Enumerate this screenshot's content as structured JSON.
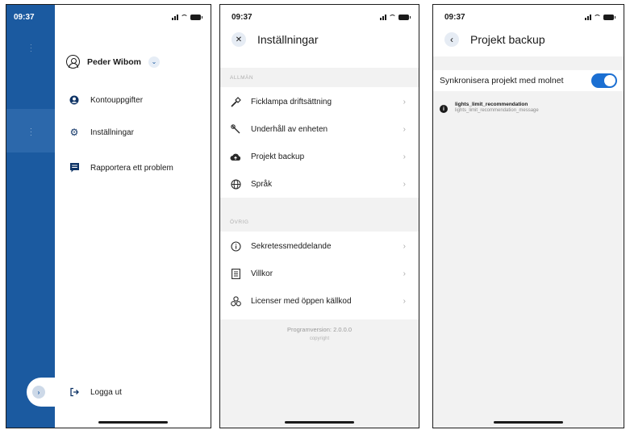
{
  "status": {
    "time": "09:37"
  },
  "drawer": {
    "profile_name": "Peder Wibom",
    "items": [
      {
        "label": "Kontouppgifter",
        "icon": "account-icon"
      },
      {
        "label": "Inställningar",
        "icon": "gear-icon"
      },
      {
        "label": "Rapportera ett problem",
        "icon": "report-icon"
      }
    ],
    "logout_label": "Logga ut"
  },
  "settings": {
    "title": "Inställningar",
    "section_general": "ALLMÄN",
    "general_items": [
      {
        "label": "Ficklampa driftsättning",
        "icon": "flashlight-icon"
      },
      {
        "label": "Underhåll av enheten",
        "icon": "wrench-icon"
      },
      {
        "label": "Projekt backup",
        "icon": "cloud-upload-icon"
      },
      {
        "label": "Språk",
        "icon": "globe-icon"
      }
    ],
    "section_other": "ÖVRIG",
    "other_items": [
      {
        "label": "Sekretessmeddelande",
        "icon": "info-circle-icon"
      },
      {
        "label": "Villkor",
        "icon": "document-icon"
      },
      {
        "label": "Licenser med öppen källkod",
        "icon": "open-source-icon"
      }
    ],
    "version": "Programversion: 2.0.0.0",
    "copyright": "copyright"
  },
  "backup": {
    "title": "Projekt backup",
    "sync_label": "Synkronisera projekt med molnet",
    "sync_on": true,
    "info_title": "lights_limit_recommendation",
    "info_message": "lights_limit_recommendation_message"
  },
  "colors": {
    "brand": "#1b5aa0",
    "toggle": "#1b6fd2",
    "section_bg": "#f2f2f2"
  }
}
